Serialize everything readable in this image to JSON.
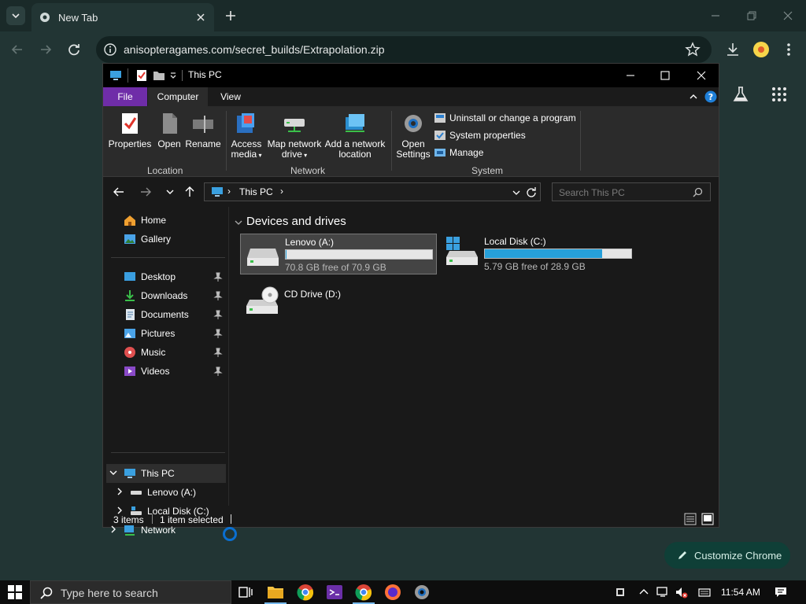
{
  "chrome": {
    "tab_title": "New Tab",
    "url": "anisopteragames.com/secret_builds/Extrapolation.zip",
    "customize_label": "Customize Chrome"
  },
  "explorer": {
    "window_title": "This PC",
    "ribbon_tabs": {
      "file": "File",
      "computer": "Computer",
      "view": "View"
    },
    "ribbon": {
      "location": {
        "label": "Location",
        "properties": "Properties",
        "open": "Open",
        "rename": "Rename"
      },
      "network": {
        "label": "Network",
        "access_media_1": "Access",
        "access_media_2": "media",
        "map_drive_1": "Map network",
        "map_drive_2": "drive",
        "add_location_1": "Add a network",
        "add_location_2": "location"
      },
      "system": {
        "label": "System",
        "open_settings_1": "Open",
        "open_settings_2": "Settings",
        "uninstall": "Uninstall or change a program",
        "system_properties": "System properties",
        "manage": "Manage"
      }
    },
    "address": {
      "crumb": "This PC"
    },
    "search": {
      "placeholder": "Search This PC"
    },
    "nav": {
      "home": "Home",
      "gallery": "Gallery",
      "desktop": "Desktop",
      "downloads": "Downloads",
      "documents": "Documents",
      "pictures": "Pictures",
      "music": "Music",
      "videos": "Videos",
      "this_pc": "This PC",
      "lenovo": "Lenovo (A:)",
      "local_disk": "Local Disk (C:)",
      "network": "Network"
    },
    "content": {
      "section": "Devices and drives",
      "drives": [
        {
          "name": "Lenovo (A:)",
          "free": "70.8 GB free of 70.9 GB",
          "used_fraction": 0.0014
        },
        {
          "name": "Local Disk (C:)",
          "free": "5.79 GB free of 28.9 GB",
          "used_fraction": 0.8
        },
        {
          "name": "CD Drive (D:)"
        }
      ]
    },
    "status": {
      "items": "3 items",
      "selected": "1 item selected"
    }
  },
  "taskbar": {
    "search_placeholder": "Type here to search",
    "clock": "11:54 AM"
  },
  "colors": {
    "accent_file_tab": "#6f2da8",
    "drive_bar_fill": "#26a0da",
    "chrome_bg": "#223534"
  }
}
